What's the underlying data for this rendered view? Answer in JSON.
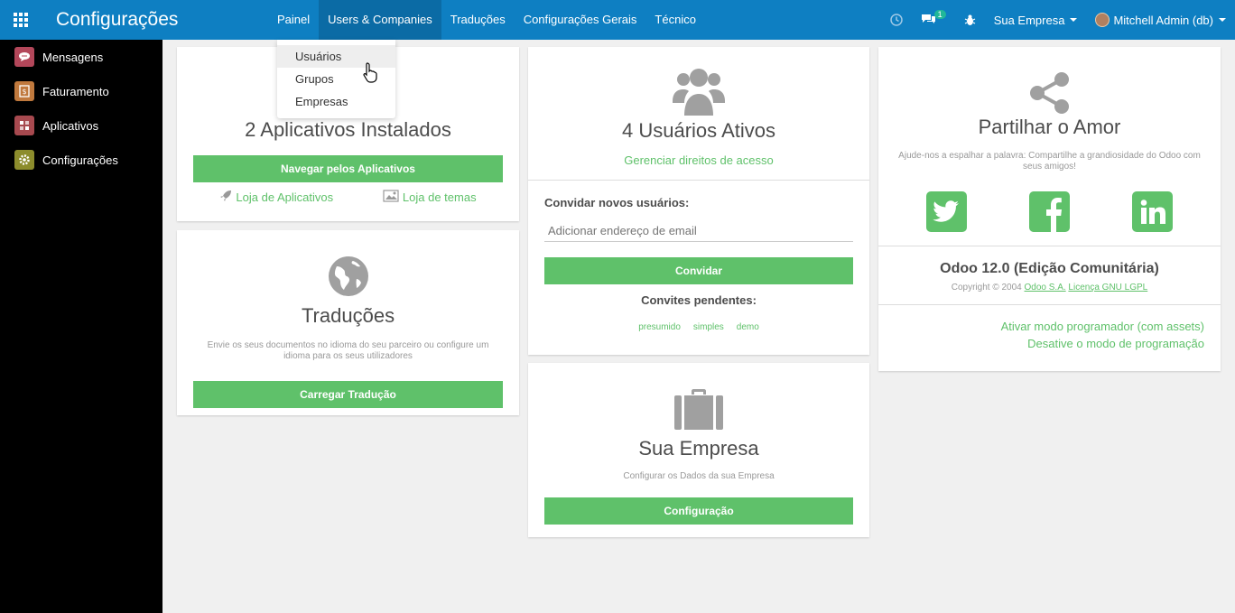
{
  "navbar": {
    "app_title": "Configurações",
    "menu": [
      "Painel",
      "Users & Companies",
      "Traduções",
      "Configurações Gerais",
      "Técnico"
    ],
    "company": "Sua Empresa",
    "user": "Mitchell Admin (db)",
    "chat_count": "1"
  },
  "dropdown": {
    "items": [
      "Usuários",
      "Grupos",
      "Empresas"
    ]
  },
  "sidebar": {
    "items": [
      {
        "label": "Mensagens",
        "color": "#b3475a"
      },
      {
        "label": "Faturamento",
        "color": "#c0793d"
      },
      {
        "label": "Aplicativos",
        "color": "#a7494f"
      },
      {
        "label": "Configurações",
        "color": "#8c8c2c"
      }
    ]
  },
  "apps_card": {
    "title": "2 Aplicativos Instalados",
    "button": "Navegar pelos Aplicativos",
    "link_store": "Loja de Aplicativos",
    "link_themes": "Loja de temas"
  },
  "translations_card": {
    "title": "Traduções",
    "description": "Envie os seus documentos no idioma do seu parceiro ou configure um idioma para os seus utilizadores",
    "button": "Carregar Tradução"
  },
  "users_card": {
    "title": "4 Usuários Ativos",
    "manage_link": "Gerenciar direitos de acesso",
    "invite_label": "Convidar novos usuários:",
    "email_placeholder": "Adicionar endereço de email",
    "invite_button": "Convidar",
    "pending_label": "Convites pendentes:",
    "pending": [
      "presumido",
      "simples",
      "demo"
    ]
  },
  "company_card": {
    "title": "Sua Empresa",
    "description": "Configurar os Dados da sua Empresa",
    "button": "Configuração"
  },
  "share_card": {
    "title": "Partilhar o Amor",
    "description": "Ajude-nos a espalhar a palavra: Compartilhe a grandiosidade do Odoo com seus amigos!",
    "social": [
      "twitter-icon",
      "facebook-icon",
      "linkedin-icon"
    ],
    "version": "Odoo 12.0 (Edição Comunitária)",
    "copyright": "Copyright © 2004",
    "copyright_company": "Odoo S.A.",
    "license": "Licença GNU LGPL",
    "dev_mode_assets": "Ativar modo programador (com assets)",
    "dev_mode_disable": "Desative o modo de programação"
  },
  "colors": {
    "navbar": "#0e7fc2",
    "green": "#5fc16a",
    "icon_gray": "#a0a0a0"
  }
}
